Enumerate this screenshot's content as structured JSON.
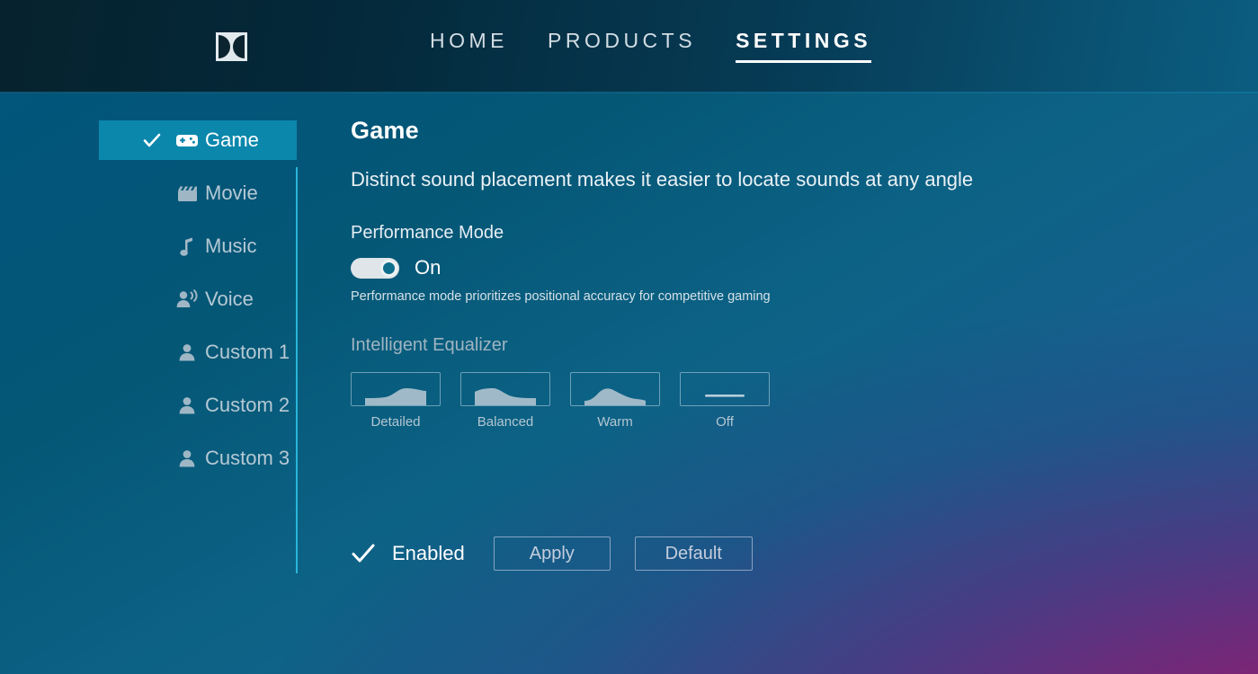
{
  "brand": {
    "logo_icon": "dolby-logo-icon"
  },
  "nav": {
    "items": [
      {
        "label": "HOME",
        "active": false
      },
      {
        "label": "PRODUCTS",
        "active": false
      },
      {
        "label": "SETTINGS",
        "active": true
      }
    ]
  },
  "sidebar": {
    "items": [
      {
        "label": "Game",
        "icon": "gamepad-icon",
        "active": true,
        "checked": true
      },
      {
        "label": "Movie",
        "icon": "clapperboard-icon",
        "active": false,
        "checked": false
      },
      {
        "label": "Music",
        "icon": "music-note-icon",
        "active": false,
        "checked": false
      },
      {
        "label": "Voice",
        "icon": "person-speaking-icon",
        "active": false,
        "checked": false
      },
      {
        "label": "Custom 1",
        "icon": "person-icon",
        "active": false,
        "checked": false
      },
      {
        "label": "Custom 2",
        "icon": "person-icon",
        "active": false,
        "checked": false
      },
      {
        "label": "Custom 3",
        "icon": "person-icon",
        "active": false,
        "checked": false
      }
    ]
  },
  "main": {
    "title": "Game",
    "subtitle": "Distinct sound placement makes it easier to locate sounds at any angle",
    "performance_mode": {
      "label": "Performance Mode",
      "state": "On",
      "enabled": true,
      "hint": "Performance mode prioritizes positional accuracy for competitive gaming"
    },
    "equalizer": {
      "label": "Intelligent Equalizer",
      "options": [
        {
          "label": "Detailed",
          "shape": "eq-curve-detailed",
          "selected": false
        },
        {
          "label": "Balanced",
          "shape": "eq-curve-balanced",
          "selected": false
        },
        {
          "label": "Warm",
          "shape": "eq-curve-warm",
          "selected": false
        },
        {
          "label": "Off",
          "shape": "eq-curve-flat",
          "selected": false
        }
      ]
    }
  },
  "footer": {
    "enabled_label": "Enabled",
    "enabled_checked": true,
    "apply_label": "Apply",
    "default_label": "Default"
  },
  "colors": {
    "accent_cyan": "#2ec6e8",
    "active_row": "#0b87ac",
    "nav_bar": "#04293a",
    "body_blue": "#05577a",
    "body_magenta": "#8b1f6e",
    "text_primary": "#ffffff",
    "text_muted": "#b4c6d2"
  }
}
